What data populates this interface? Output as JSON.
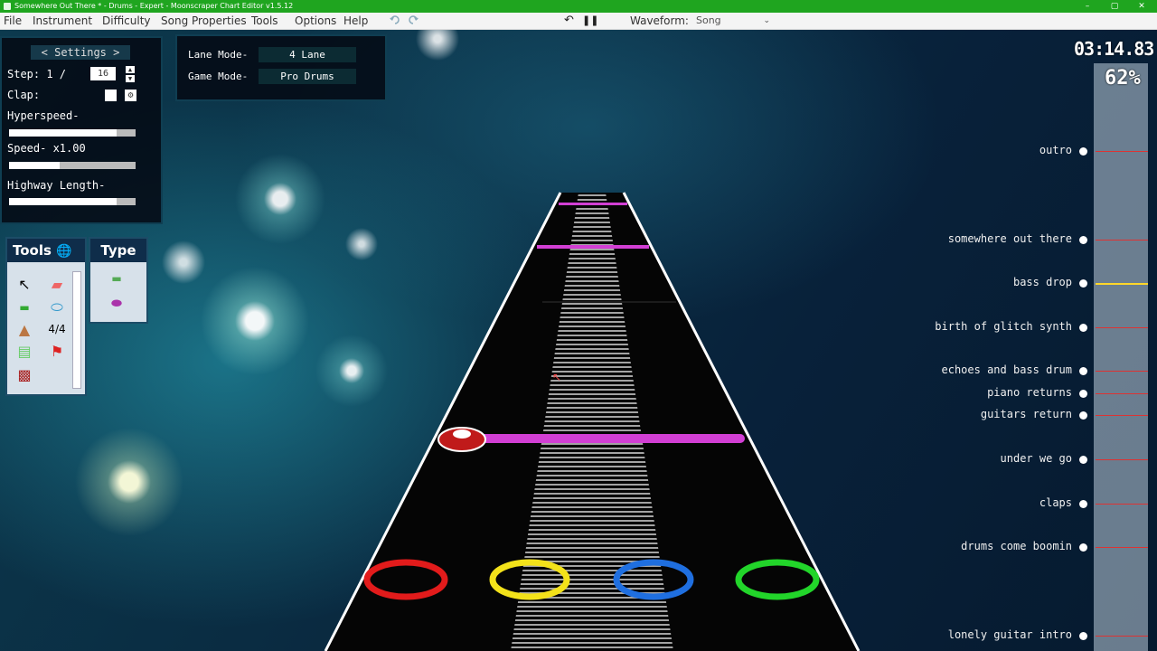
{
  "window": {
    "title": "Somewhere Out There * - Drums - Expert - Moonscraper Chart Editor v1.5.12",
    "controls": [
      "–",
      "▢",
      "✕"
    ]
  },
  "menu": [
    "File",
    "Instrument",
    "Difficulty",
    "Song Properties",
    "Tools",
    "Options",
    "Help"
  ],
  "toolbar": {
    "undo_icon": "undo-icon",
    "redo_icon": "redo-icon",
    "step_back": "↶",
    "pause": "❚❚",
    "waveform_label": "Waveform:",
    "waveform_value": "Song"
  },
  "settings": {
    "header": "< Settings >",
    "step_label": "Step: 1 /",
    "step_value": "16",
    "clap_label": "Clap:",
    "hyperspeed_label": "Hyperspeed-",
    "hyperspeed_level": 0.85,
    "speed_label": "Speed- x1.00",
    "speed_level": 0.4,
    "highway_label": "Highway Length-",
    "highway_level": 0.85
  },
  "modes": {
    "lane_label": "Lane Mode-",
    "lane_value": "4 Lane",
    "game_label": "Game Mode-",
    "game_value": "Pro Drums"
  },
  "tools": {
    "header": "Tools",
    "type_header": "Type"
  },
  "playback": {
    "time": "03:14.83",
    "progress": "62%",
    "progress_fraction": 0.62
  },
  "sections": [
    {
      "label": "outro"
    },
    {
      "label": "somewhere out there"
    },
    {
      "label": "bass drop"
    },
    {
      "label": "birth of glitch synth"
    },
    {
      "label": "echoes and bass drum"
    },
    {
      "label": "piano returns"
    },
    {
      "label": "guitars return"
    },
    {
      "label": "under we go"
    },
    {
      "label": "claps"
    },
    {
      "label": "drums come boomin"
    },
    {
      "label": "lonely guitar intro"
    }
  ],
  "colors": {
    "title_bar": "#1fa51f",
    "lane_red": "#e21b1b",
    "lane_yellow": "#f3e21a",
    "lane_blue": "#1f6fe0",
    "lane_green": "#22d52a",
    "kick_bar": "#d23fd4",
    "current_marker": "#ffd72a"
  }
}
